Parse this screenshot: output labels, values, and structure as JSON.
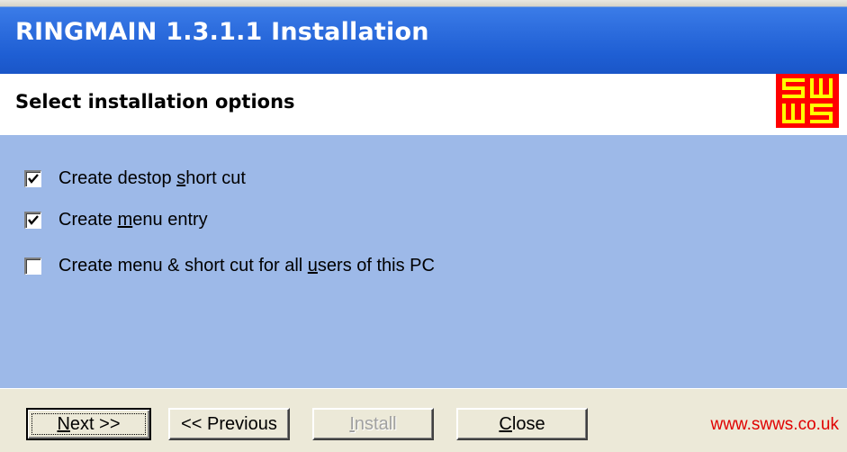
{
  "window": {
    "title": "RINGMAIN 1.3.1.1 Installation"
  },
  "header": {
    "subtitle": "Select installation options",
    "logo_text": "SWWS",
    "logo_color": "#ff0000",
    "logo_fg_color": "#ffff00"
  },
  "options": {
    "background_color": "#9db9e8",
    "items": [
      {
        "label_pre": "Create destop ",
        "label_key": "s",
        "label_post": "hort cut",
        "checked": true
      },
      {
        "label_pre": "Create ",
        "label_key": "m",
        "label_post": "enu entry",
        "checked": true
      },
      {
        "label_pre": "Create menu & short cut for all ",
        "label_key": "u",
        "label_post": "sers of this PC",
        "checked": false
      }
    ]
  },
  "footer": {
    "next": {
      "label_pre": "",
      "label_key": "N",
      "label_post": "ext >>"
    },
    "previous": {
      "label": "<< Previous"
    },
    "install": {
      "label_pre": "",
      "label_key": "I",
      "label_post": "nstall",
      "enabled": false
    },
    "close": {
      "label_pre": "",
      "label_key": "C",
      "label_post": "lose"
    },
    "link": "www.swws.co.uk",
    "link_color": "#e00000"
  }
}
